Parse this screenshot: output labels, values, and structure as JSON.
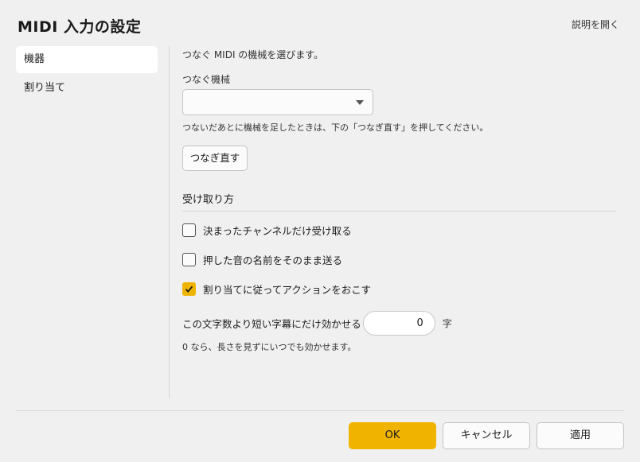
{
  "dialog": {
    "title": "MIDI 入力の設定",
    "help_link": "説明を開く"
  },
  "sidebar": {
    "items": [
      {
        "label": "機器",
        "active": true
      },
      {
        "label": "割り当て",
        "active": false
      }
    ]
  },
  "device": {
    "description": "つなぐ MIDI の機械を選びます。",
    "select_label": "つなぐ機械",
    "select_value": "",
    "hint": "つないだあとに機械を足したときは、下の「つなぎ直す」を押してください。",
    "reconnect_label": "つなぎ直す"
  },
  "receive": {
    "section_title": "受け取り方",
    "options": [
      {
        "label": "決まったチャンネルだけ受け取る",
        "checked": false
      },
      {
        "label": "押した音の名前をそのまま送る",
        "checked": false
      },
      {
        "label": "割り当てに従ってアクションをおこす",
        "checked": true
      }
    ],
    "min_chars_label": "この文字数より短い字幕にだけ効かせる",
    "min_chars_value": "0",
    "min_chars_unit": "字",
    "min_chars_note": "0 なら、長さを見ずにいつでも効かせます。"
  },
  "footer": {
    "ok_label": "OK",
    "cancel_label": "キャンセル",
    "apply_label": "適用"
  },
  "colors": {
    "accent": "#f0b400",
    "background": "#f0f0f0"
  }
}
